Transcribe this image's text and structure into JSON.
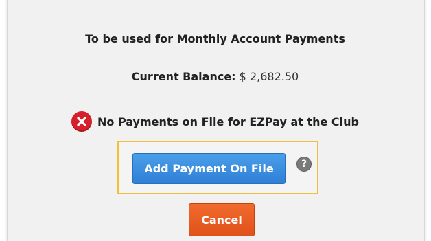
{
  "dialog": {
    "heading": "To be used for Monthly Account Payments",
    "balance_label": "Current Balance:",
    "balance_value": "$ 2,682.50",
    "status_message": "No Payments on File for EZPay at the Club",
    "status_icon": "error-x-icon",
    "add_button_label": "Add Payment On File",
    "help_icon_glyph": "?",
    "cancel_button_label": "Cancel"
  },
  "colors": {
    "primary_button": "#2f7fd6",
    "cancel_button": "#e0521a",
    "error_icon": "#d6202c",
    "highlight_border": "#f0c03a",
    "help_icon": "#7a7a7a"
  }
}
